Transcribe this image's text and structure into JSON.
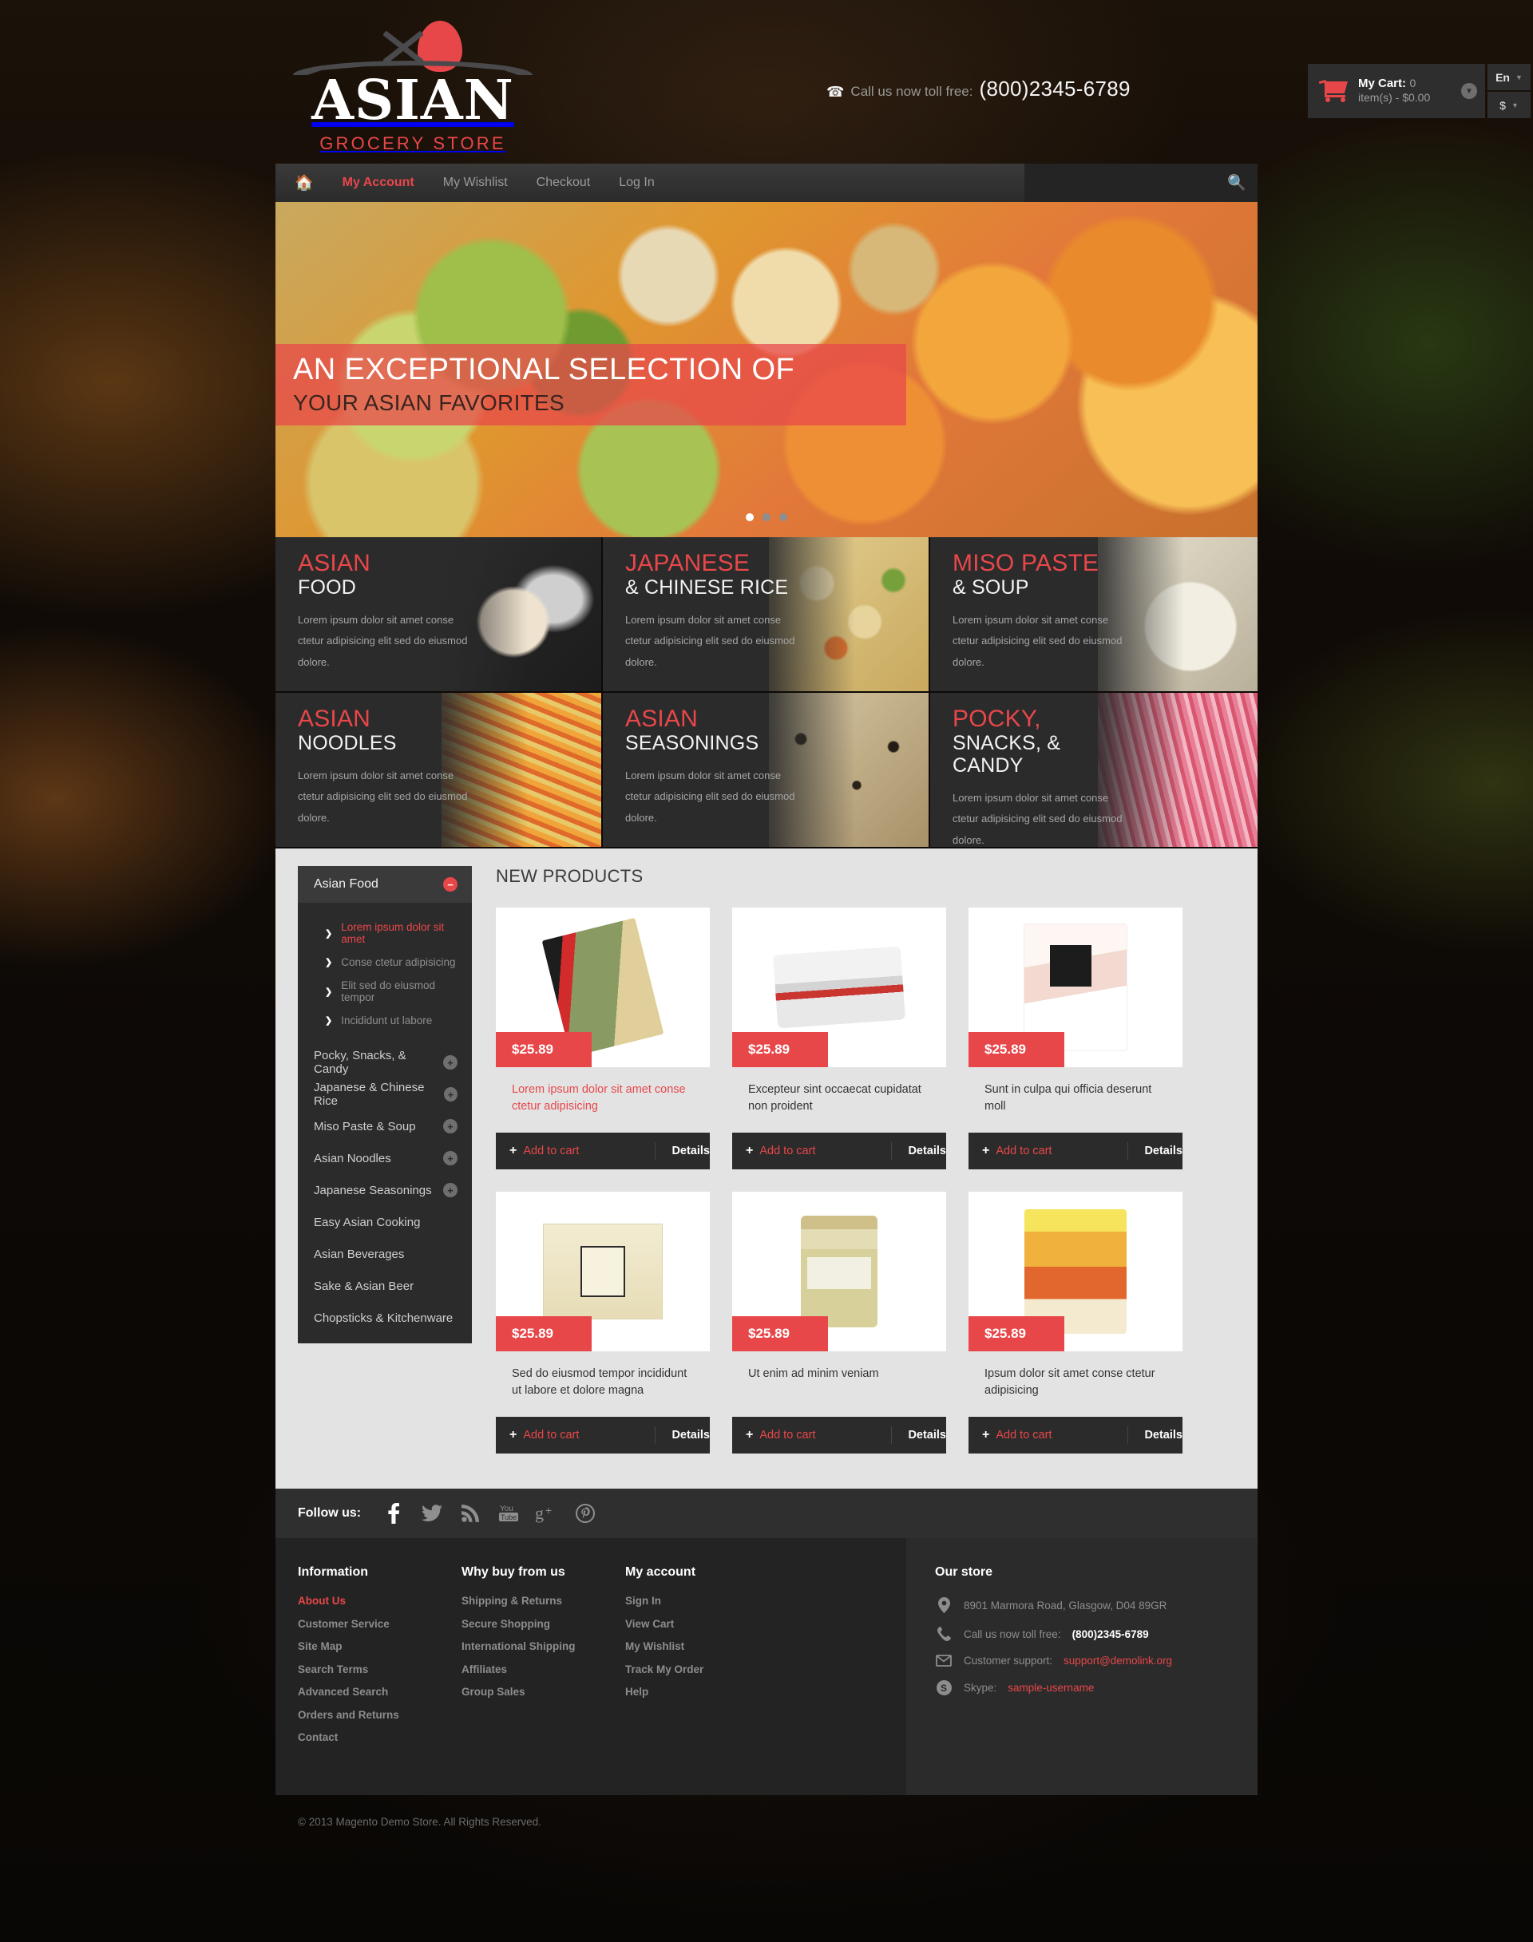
{
  "header": {
    "logo": {
      "word": "ASIAN",
      "sub": "GROCERY STORE"
    },
    "phone_label": "Call us now toll free:",
    "phone_number": "(800)2345-6789",
    "cart": {
      "title": "My Cart:",
      "summary": "0 item(s) - $0.00"
    },
    "language": "En",
    "currency": "$"
  },
  "nav": {
    "items": [
      {
        "label": "My Account",
        "active": true
      },
      {
        "label": "My Wishlist",
        "active": false
      },
      {
        "label": "Checkout",
        "active": false
      },
      {
        "label": "Log In",
        "active": false
      }
    ],
    "search_placeholder": ""
  },
  "hero": {
    "line1": "AN EXCEPTIONAL SELECTION OF",
    "line2": "YOUR ASIAN FAVORITES",
    "slide_count": 3,
    "active_slide": 1
  },
  "tiles": [
    {
      "title": "ASIAN",
      "subtitle": "FOOD",
      "text": "Lorem ipsum dolor sit amet conse ctetur adipisicing elit sed do eiusmod dolore."
    },
    {
      "title": "JAPANESE",
      "subtitle": "& CHINESE RICE",
      "text": "Lorem ipsum dolor sit amet conse ctetur adipisicing elit sed do eiusmod dolore."
    },
    {
      "title": "MISO PASTE",
      "subtitle": "& SOUP",
      "text": "Lorem ipsum dolor sit amet conse ctetur adipisicing elit sed do eiusmod dolore."
    },
    {
      "title": "ASIAN",
      "subtitle": "NOODLES",
      "text": "Lorem ipsum dolor sit amet conse ctetur adipisicing elit sed do eiusmod dolore."
    },
    {
      "title": "ASIAN",
      "subtitle": "SEASONINGS",
      "text": "Lorem ipsum dolor sit amet conse ctetur adipisicing elit sed do eiusmod dolore."
    },
    {
      "title": "POCKY,",
      "subtitle": "SNACKS, & CANDY",
      "text": "Lorem ipsum dolor sit amet conse ctetur adipisicing elit sed do eiusmod dolore."
    }
  ],
  "sidebar": {
    "open_group": {
      "label": "Asian Food",
      "toggle": "minus"
    },
    "sub_items": [
      {
        "label": "Lorem ipsum dolor sit amet",
        "active": true
      },
      {
        "label": "Conse ctetur adipisicing",
        "active": false
      },
      {
        "label": "Elit sed do eiusmod tempor",
        "active": false
      },
      {
        "label": "Incididunt ut labore",
        "active": false
      }
    ],
    "items": [
      {
        "label": "Pocky, Snacks, & Candy",
        "toggle": "plus"
      },
      {
        "label": "Japanese & Chinese Rice",
        "toggle": "plus"
      },
      {
        "label": "Miso Paste & Soup",
        "toggle": "plus"
      },
      {
        "label": "Asian Noodles",
        "toggle": "plus"
      },
      {
        "label": "Japanese Seasonings",
        "toggle": "plus"
      },
      {
        "label": "Easy Asian Cooking",
        "toggle": ""
      },
      {
        "label": "Asian Beverages",
        "toggle": ""
      },
      {
        "label": "Sake & Asian Beer",
        "toggle": ""
      },
      {
        "label": "Chopsticks & Kitchenware",
        "toggle": ""
      }
    ]
  },
  "main": {
    "heading": "NEW PRODUCTS",
    "add_to_cart_label": "Add to cart",
    "details_label": "Details",
    "products": [
      {
        "price": "$25.89",
        "name": "Lorem ipsum dolor sit amet conse ctetur adipisicing",
        "highlight": true,
        "art": "p-udon"
      },
      {
        "price": "$25.89",
        "name": "Excepteur sint occaecat cupidatat non proident",
        "highlight": false,
        "art": "p-tin"
      },
      {
        "price": "$25.89",
        "name": "Sunt in culpa qui officia deserunt moll",
        "highlight": false,
        "art": "p-bag"
      },
      {
        "price": "$25.89",
        "name": "Sed do eiusmod tempor incididunt ut labore et dolore magna",
        "highlight": false,
        "art": "p-flat"
      },
      {
        "price": "$25.89",
        "name": "Ut enim ad minim veniam",
        "highlight": false,
        "art": "p-jar"
      },
      {
        "price": "$25.89",
        "name": "Ipsum dolor sit amet conse ctetur adipisicing",
        "highlight": false,
        "art": "p-pouch"
      }
    ]
  },
  "follow": {
    "label": "Follow us:",
    "networks": [
      "facebook",
      "twitter",
      "rss",
      "youtube",
      "google-plus",
      "pinterest"
    ]
  },
  "footer": {
    "columns": [
      {
        "title": "Information",
        "links": [
          {
            "label": "About Us",
            "highlight": true
          },
          {
            "label": "Customer Service",
            "highlight": false
          },
          {
            "label": "Site Map",
            "highlight": false
          },
          {
            "label": "Search Terms",
            "highlight": false
          },
          {
            "label": "Advanced Search",
            "highlight": false
          },
          {
            "label": "Orders and Returns",
            "highlight": false
          },
          {
            "label": "Contact",
            "highlight": false
          }
        ]
      },
      {
        "title": "Why buy from us",
        "links": [
          {
            "label": "Shipping & Returns",
            "highlight": false
          },
          {
            "label": "Secure Shopping",
            "highlight": false
          },
          {
            "label": "International Shipping",
            "highlight": false
          },
          {
            "label": "Affiliates",
            "highlight": false
          },
          {
            "label": "Group Sales",
            "highlight": false
          }
        ]
      },
      {
        "title": "My account",
        "links": [
          {
            "label": "Sign In",
            "highlight": false
          },
          {
            "label": "View Cart",
            "highlight": false
          },
          {
            "label": "My Wishlist",
            "highlight": false
          },
          {
            "label": "Track My Order",
            "highlight": false
          },
          {
            "label": "Help",
            "highlight": false
          }
        ]
      }
    ],
    "store": {
      "title": "Our store",
      "address": "8901 Marmora Road, Glasgow, D04 89GR",
      "phone_label": "Call us now toll free:",
      "phone_number": "(800)2345-6789",
      "support_label": "Customer support:",
      "support_email": "support@demolink.org",
      "skype_label": "Skype:",
      "skype_value": "sample-username"
    },
    "copyright": "© 2013 Magento Demo Store. All Rights Reserved."
  },
  "colors": {
    "accent": "#e8474a",
    "dark": "#2b2b2b",
    "panel": "#e3e3e3"
  }
}
